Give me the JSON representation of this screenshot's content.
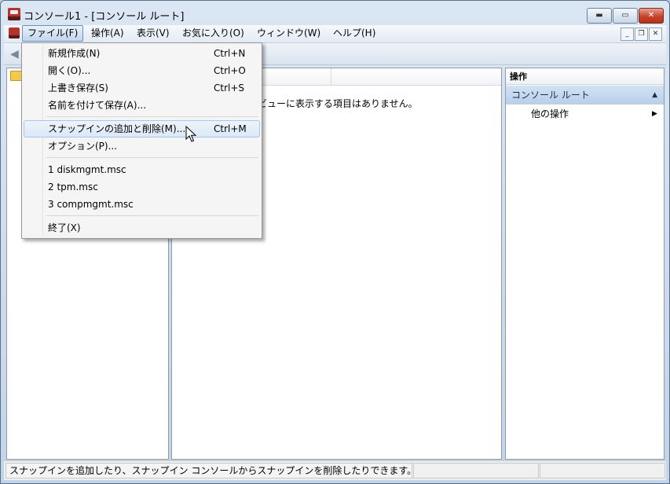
{
  "window": {
    "title": "コンソール1 - [コンソール ルート]"
  },
  "caption_buttons": {
    "minimize": "▬",
    "maximize": "▭",
    "close": "✕"
  },
  "menubar": {
    "items": [
      "ファイル(F)",
      "操作(A)",
      "表示(V)",
      "お気に入り(O)",
      "ウィンドウ(W)",
      "ヘルプ(H)"
    ],
    "active": "ファイル(F)"
  },
  "mdi_buttons": {
    "minimize": "_",
    "restore": "❐",
    "close": "✕"
  },
  "center": {
    "empty_message": "のビューに表示する項目はありません。"
  },
  "actions": {
    "header": "操作",
    "group": "コンソール ルート",
    "more": "他の操作"
  },
  "file_menu": {
    "items": [
      {
        "label": "新規作成(N)",
        "shortcut": "Ctrl+N"
      },
      {
        "label": "開く(O)...",
        "shortcut": "Ctrl+O"
      },
      {
        "label": "上書き保存(S)",
        "shortcut": "Ctrl+S"
      },
      {
        "label": "名前を付けて保存(A)...",
        "shortcut": ""
      },
      {
        "label": "スナップインの追加と削除(M)...",
        "shortcut": "Ctrl+M"
      },
      {
        "label": "オプション(P)...",
        "shortcut": ""
      },
      {
        "label": "1 diskmgmt.msc",
        "shortcut": ""
      },
      {
        "label": "2 tpm.msc",
        "shortcut": ""
      },
      {
        "label": "3 compmgmt.msc",
        "shortcut": ""
      },
      {
        "label": "終了(X)",
        "shortcut": ""
      }
    ],
    "highlighted": "スナップインの追加と削除(M)..."
  },
  "statusbar": {
    "text": "スナップインを追加したり、スナップイン コンソールからスナップインを削除したりできます。"
  }
}
